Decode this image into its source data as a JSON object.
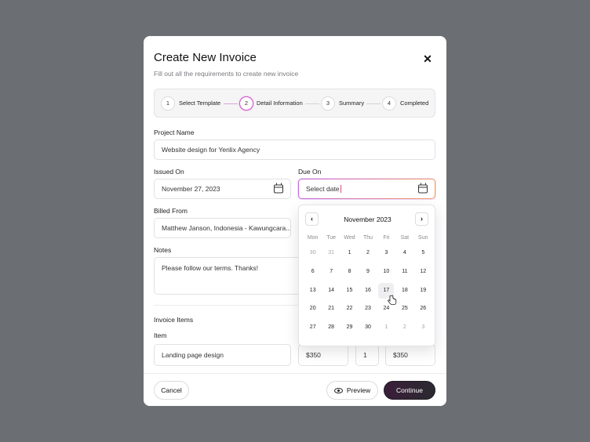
{
  "modal": {
    "title": "Create New Invoice",
    "subtitle": "Fill out all the requirements to create new invoice",
    "close_icon": "x-icon"
  },
  "steps": [
    {
      "number": "1",
      "label": "Select Template",
      "state": "done"
    },
    {
      "number": "2",
      "label": "Detail Information",
      "state": "active"
    },
    {
      "number": "3",
      "label": "Summary",
      "state": "pending"
    },
    {
      "number": "4",
      "label": "Completed",
      "state": "pending"
    }
  ],
  "form": {
    "project_name_label": "Project Name",
    "project_name_value": "Website design for Yenlix Agency",
    "issued_on_label": "Issued On",
    "issued_on_value": "November 27, 2023",
    "due_on_label": "Due On",
    "due_on_placeholder": "Select date",
    "billed_from_label": "Billed From",
    "billed_from_value": "Matthew Janson, Indonesia - Kawungcara...",
    "notes_label": "Notes",
    "notes_value": "Please follow our terms. Thanks!"
  },
  "invoice_items": {
    "section_label": "Invoice Items",
    "item_label": "Item",
    "rows": [
      {
        "item": "Landing page design",
        "rate": "$350",
        "qty": "1",
        "amount": "$350"
      }
    ]
  },
  "footer": {
    "cancel_label": "Cancel",
    "preview_label": "Preview",
    "continue_label": "Continue"
  },
  "calendar": {
    "month_label": "November 2023",
    "weekdays": [
      "Mon",
      "Tue",
      "Wed",
      "Thu",
      "Fri",
      "Sat",
      "Sun"
    ],
    "weeks": [
      [
        "30",
        "31",
        "1",
        "2",
        "3",
        "4",
        "5"
      ],
      [
        "6",
        "7",
        "8",
        "9",
        "10",
        "11",
        "12"
      ],
      [
        "13",
        "14",
        "15",
        "16",
        "17",
        "18",
        "19"
      ],
      [
        "20",
        "21",
        "22",
        "23",
        "24",
        "25",
        "26"
      ],
      [
        "27",
        "28",
        "29",
        "30",
        "1",
        "2",
        "3"
      ]
    ],
    "hovered_day": "17",
    "prev_icon": "chevron-left-icon",
    "next_icon": "chevron-right-icon"
  },
  "colors": {
    "backdrop": "#6b6e72",
    "accent_gradient_start": "#c46ad6",
    "accent_gradient_end": "#f0a05e",
    "primary_button": "#2a2a30"
  }
}
